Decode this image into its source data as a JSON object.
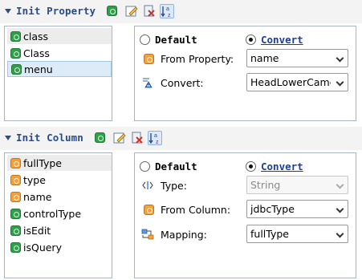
{
  "property_section": {
    "title": "Init Property",
    "list": [
      {
        "label": "class",
        "badge": "green",
        "state": "selected-gray"
      },
      {
        "label": "Class",
        "badge": "green",
        "state": "normal"
      },
      {
        "label": "menu",
        "badge": "green",
        "state": "selected-blue"
      }
    ],
    "radio_default": "Default",
    "radio_convert": "Convert",
    "selected_radio": "Convert",
    "fields": [
      {
        "label": "From Property:",
        "value": "name",
        "icon": "orange-badge-icon"
      },
      {
        "label": "Convert:",
        "value": "HeadLowerCamel",
        "icon": "convert-icon"
      }
    ]
  },
  "column_section": {
    "title": "Init Column",
    "list": [
      {
        "label": "fullType",
        "badge": "orange",
        "state": "selected-gray"
      },
      {
        "label": "type",
        "badge": "orange",
        "state": "normal"
      },
      {
        "label": "name",
        "badge": "orange",
        "state": "normal"
      },
      {
        "label": "controlType",
        "badge": "green",
        "state": "normal"
      },
      {
        "label": "isEdit",
        "badge": "green",
        "state": "normal"
      },
      {
        "label": "isQuery",
        "badge": "green",
        "state": "normal"
      }
    ],
    "radio_default": "Default",
    "radio_convert": "Convert",
    "selected_radio": "Convert",
    "fields": [
      {
        "label": "Type:",
        "value": "String",
        "icon": "type-icon",
        "disabled": true
      },
      {
        "label": "From Column:",
        "value": "jdbcType",
        "icon": "orange-badge-icon"
      },
      {
        "label": "Mapping:",
        "value": "fullType",
        "icon": "mapping-icon"
      }
    ]
  },
  "colors": {
    "title_blue": "#294b8e",
    "badge_green": "#2fa04a",
    "badge_orange": "#f2a13a",
    "link_blue": "#1b3ea5",
    "selection_blue": "#dcebf7"
  }
}
